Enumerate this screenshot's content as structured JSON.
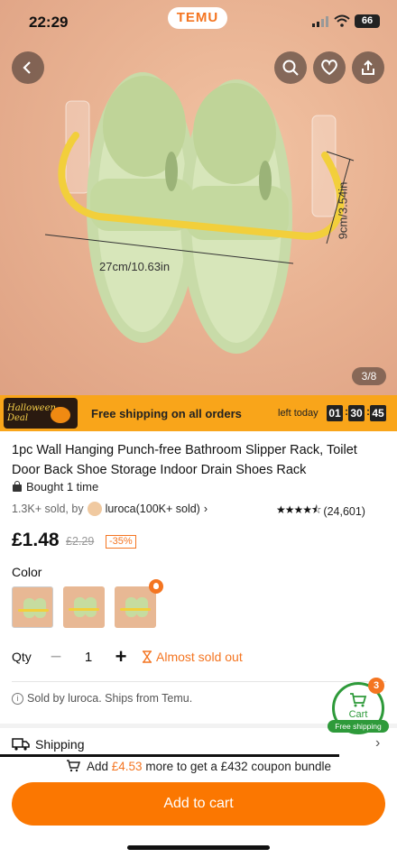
{
  "status_bar": {
    "time": "22:29",
    "battery": "66"
  },
  "header": {
    "logo": "TEMU"
  },
  "gallery": {
    "counter": "3/8",
    "dim_width": "27cm/10.63in",
    "dim_height": "9cm/3.54in"
  },
  "promo": {
    "badge": "Halloween Deal",
    "text": "Free shipping on all orders",
    "left_today": "left today",
    "timer": [
      "01",
      "30",
      "45"
    ]
  },
  "product": {
    "title": "1pc Wall Hanging Punch-free Bathroom Slipper Rack, Toilet Door Back Shoe Storage Indoor Drain Shoes Rack",
    "bought": "Bought 1 time",
    "sold_prefix": "1.3K+ sold, by",
    "seller": "luroca(100K+ sold)",
    "rating_count": "(24,601)",
    "rating_value": 4.5,
    "price": "£1.48",
    "old_price": "£2.29",
    "discount": "-35%"
  },
  "options": {
    "color_label": "Color",
    "qty_label": "Qty",
    "qty_value": "1",
    "almost_sold_out": "Almost sold out"
  },
  "seller_info": {
    "sold_by": "Sold by luroca. Ships from Temu."
  },
  "cart_float": {
    "label": "Cart",
    "count": "3",
    "pill": "Free shipping"
  },
  "shipping": {
    "label": "Shipping"
  },
  "coupon": {
    "pre": "Add",
    "amount": "£4.53",
    "post": "more to get a £432 coupon bundle"
  },
  "cta": {
    "add_to_cart": "Add to cart"
  },
  "colors": {
    "accent": "#fb7701",
    "green": "#2e9a3a",
    "promo_bg": "#f9a51a"
  }
}
